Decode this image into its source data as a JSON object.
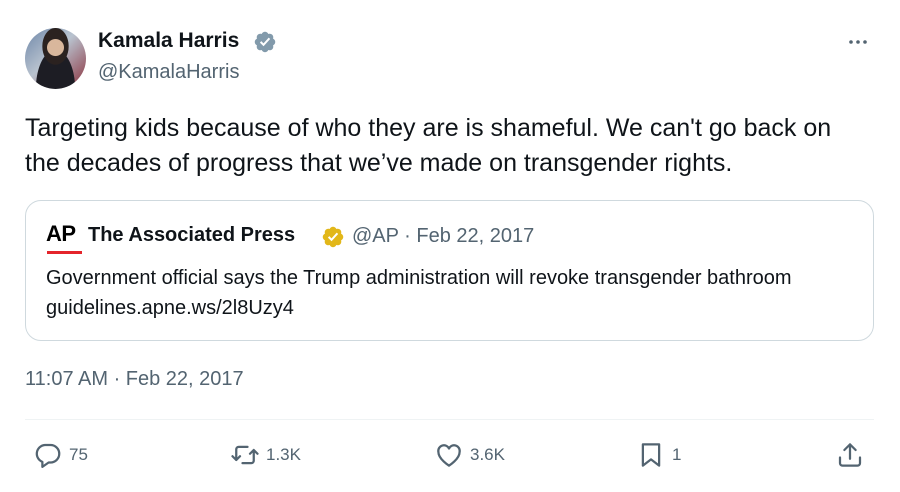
{
  "author": {
    "name": "Kamala Harris",
    "handle": "@KamalaHarris",
    "verified_color": "#829aab"
  },
  "tweet_text": "Targeting kids because of who they are is shameful. We can't go back on the decades of progress that we’ve made on transgender rights.",
  "quoted": {
    "logo_text": "AP",
    "name": "The Associated Press",
    "meta": "@AP · Feb 22, 2017",
    "text": "Government official says the Trump administration will revoke transgender bathroom guidelines.apne.ws/2l8Uzy4",
    "verified_color": "#e2b719"
  },
  "timestamp": "11:07 AM · Feb 22, 2017",
  "actions": {
    "replies": "75",
    "reposts": "1.3K",
    "likes": "3.6K",
    "bookmarks": "1"
  },
  "icons": {
    "more": "more-dots-icon",
    "reply": "reply-icon",
    "repost": "repost-icon",
    "like": "heart-icon",
    "bookmark": "bookmark-icon",
    "share": "share-icon"
  }
}
